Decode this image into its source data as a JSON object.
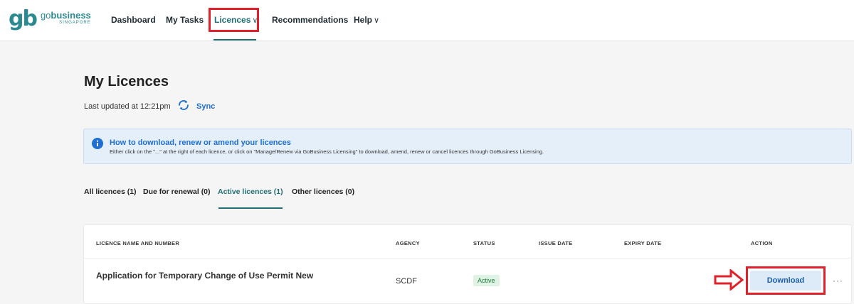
{
  "brand": {
    "logo_mark": "gb",
    "name_prefix": "go",
    "name_main": "business",
    "tagline": "SINGAPORE"
  },
  "nav": {
    "items": [
      {
        "label": "Dashboard"
      },
      {
        "label": "My Tasks"
      },
      {
        "label": "Licences",
        "active": true,
        "has_dropdown": true
      },
      {
        "label": "Recommendations"
      },
      {
        "label": "Help",
        "has_dropdown": true
      }
    ],
    "chevron": "∨"
  },
  "header": {
    "title": "My Licences",
    "last_updated": "Last updated at 12:21pm",
    "sync_label": "Sync",
    "sync_icon": "sync-icon"
  },
  "banner": {
    "icon": "info-icon",
    "title": "How to download, renew or amend your licences",
    "description": "Either click on the \"...\" at the right of each licence, or click on \"Manage/Renew via GoBusiness Licensing\" to download, amend, renew or cancel licences through GoBusiness Licensing."
  },
  "tabs": [
    {
      "label": "All licences (1)"
    },
    {
      "label": "Due for renewal (0)"
    },
    {
      "label": "Active licences (1)",
      "active": true
    },
    {
      "label": "Other licences (0)"
    }
  ],
  "table": {
    "columns": [
      "LICENCE NAME AND NUMBER",
      "AGENCY",
      "STATUS",
      "ISSUE DATE",
      "EXPIRY DATE",
      "ACTION"
    ],
    "rows": [
      {
        "name": "Application for Temporary Change of Use Permit New",
        "agency": "SCDF",
        "status": "Active",
        "issue_date": "",
        "expiry_date": "",
        "action_label": "Download",
        "more": "···"
      }
    ]
  },
  "colors": {
    "brand_teal": "#2b8a8f",
    "link_blue": "#1d6fd1",
    "highlight_red": "#e0202a",
    "status_green": "#1f7a3a"
  }
}
